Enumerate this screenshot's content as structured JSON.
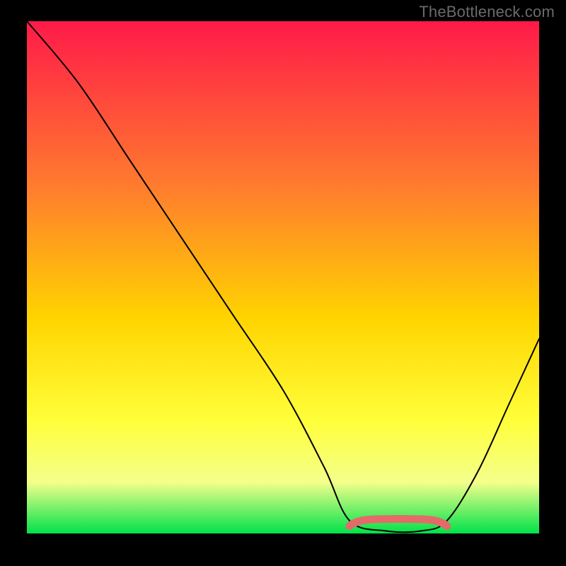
{
  "watermark": "TheBottleneck.com",
  "gradient": {
    "top": "#ff1a49",
    "mid1": "#ff7b2e",
    "mid2": "#ffd400",
    "mid3": "#ffff3a",
    "band": "#f4ff8b",
    "bottom": "#00e24a"
  },
  "chart_data": {
    "type": "line",
    "title": "",
    "xlabel": "",
    "ylabel": "",
    "xlim": [
      0,
      100
    ],
    "ylim": [
      0,
      100
    ],
    "grid": false,
    "legend": false,
    "series": [
      {
        "name": "curve",
        "x": [
          0,
          10,
          20,
          30,
          40,
          50,
          58,
          63,
          70,
          77,
          82,
          88,
          94,
          100
        ],
        "y": [
          100,
          88,
          73,
          58,
          43,
          28,
          13,
          2.5,
          0.5,
          0.5,
          2.5,
          12,
          25,
          38
        ]
      }
    ],
    "highlight_band": {
      "x_start": 63,
      "x_end": 82,
      "y": 2,
      "color": "#e46a6a"
    }
  }
}
